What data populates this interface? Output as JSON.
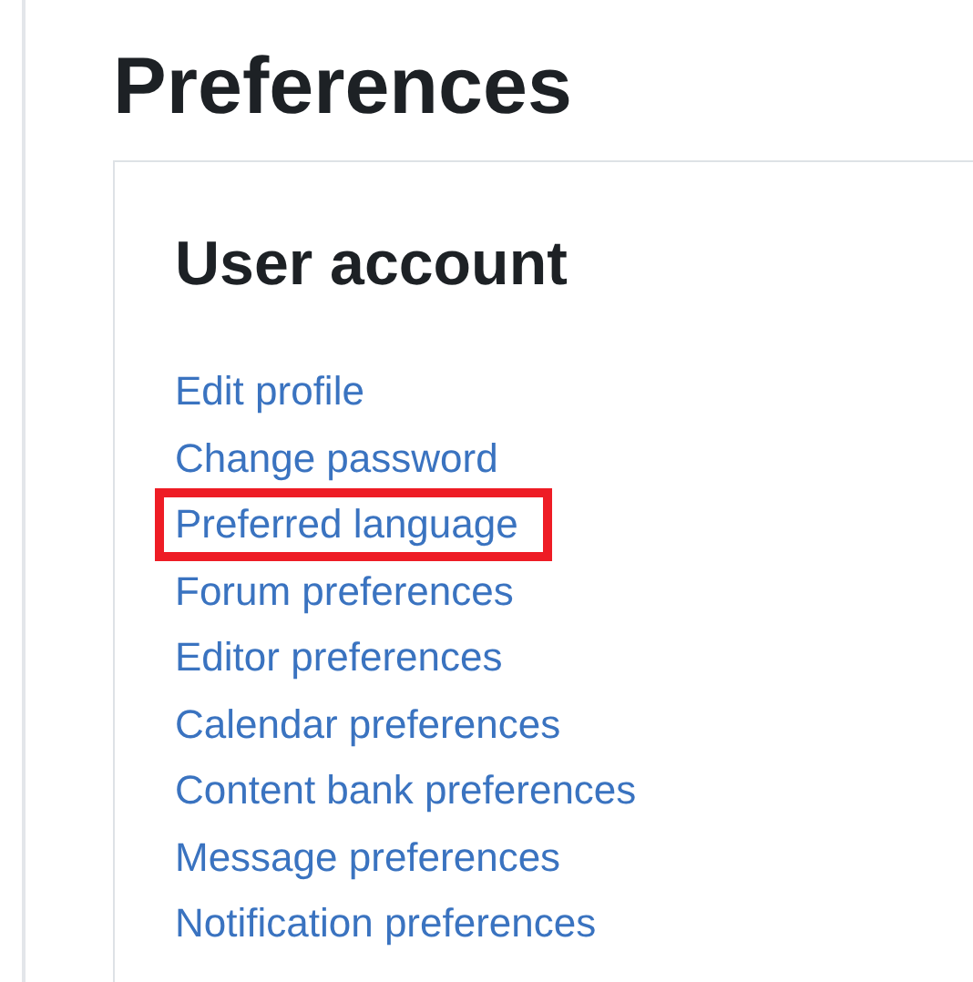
{
  "page_title": "Preferences",
  "section": {
    "title": "User account",
    "links": [
      {
        "label": "Edit profile",
        "highlighted": false
      },
      {
        "label": "Change password",
        "highlighted": false
      },
      {
        "label": "Preferred language",
        "highlighted": true
      },
      {
        "label": "Forum preferences",
        "highlighted": false
      },
      {
        "label": "Editor preferences",
        "highlighted": false
      },
      {
        "label": "Calendar preferences",
        "highlighted": false
      },
      {
        "label": "Content bank preferences",
        "highlighted": false
      },
      {
        "label": "Message preferences",
        "highlighted": false
      },
      {
        "label": "Notification preferences",
        "highlighted": false
      }
    ]
  }
}
